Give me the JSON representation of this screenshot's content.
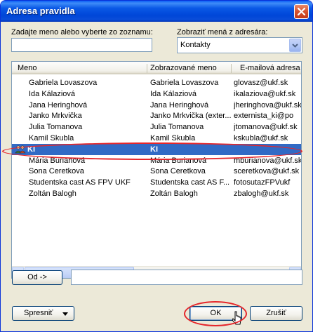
{
  "window": {
    "title": "Adresa pravidla"
  },
  "search": {
    "label": "Zadajte meno alebo vyberte zo zoznamu:",
    "value": ""
  },
  "addressbook": {
    "label": "Zobraziť mená z adresára:",
    "selected": "Kontakty"
  },
  "list": {
    "columns": [
      "Meno",
      "Zobrazované meno",
      "E-mailová adresa"
    ],
    "rows": [
      {
        "name": "Gabriela Lovaszova",
        "display": "Gabriela Lovaszova",
        "email": "glovasz@ukf.sk",
        "selected": false
      },
      {
        "name": "Ida Kálaziová",
        "display": "Ida Kálaziová",
        "email": "ikalaziova@ukf.sk",
        "selected": false
      },
      {
        "name": "Jana Heringhová",
        "display": "Jana Heringhová",
        "email": "jheringhova@ukf.sk",
        "selected": false
      },
      {
        "name": "Janko Mrkvička",
        "display": "Janko Mrkvička (exter...",
        "email": "externista_ki@po",
        "selected": false
      },
      {
        "name": "Julia Tomanova",
        "display": "Julia Tomanova",
        "email": "jtomanova@ukf.sk",
        "selected": false
      },
      {
        "name": "Kamil Skubla",
        "display": "Kamil Skubla",
        "email": "kskubla@ukf.sk",
        "selected": false
      },
      {
        "name": "KI",
        "display": "KI",
        "email": "",
        "selected": true
      },
      {
        "name": "Mária Burianová",
        "display": "Mária Burianová",
        "email": "mburianova@ukf.sk",
        "selected": false
      },
      {
        "name": "Sona Ceretkova",
        "display": "Sona Ceretkova",
        "email": "sceretkova@ukf.sk",
        "selected": false
      },
      {
        "name": "Studentska cast AS FPV UKF",
        "display": "Studentska cast AS F...",
        "email": "fotosutazFPVukf",
        "selected": false
      },
      {
        "name": "Zoltán Balogh",
        "display": "Zoltán Balogh",
        "email": "zbalogh@ukf.sk",
        "selected": false
      }
    ]
  },
  "from": {
    "button": "Od ->",
    "value": ""
  },
  "buttons": {
    "refine": "Spresniť",
    "ok": "OK",
    "cancel": "Zrušiť"
  },
  "colors": {
    "selection": "#316ac5",
    "highlight_ring": "#e5262b"
  }
}
